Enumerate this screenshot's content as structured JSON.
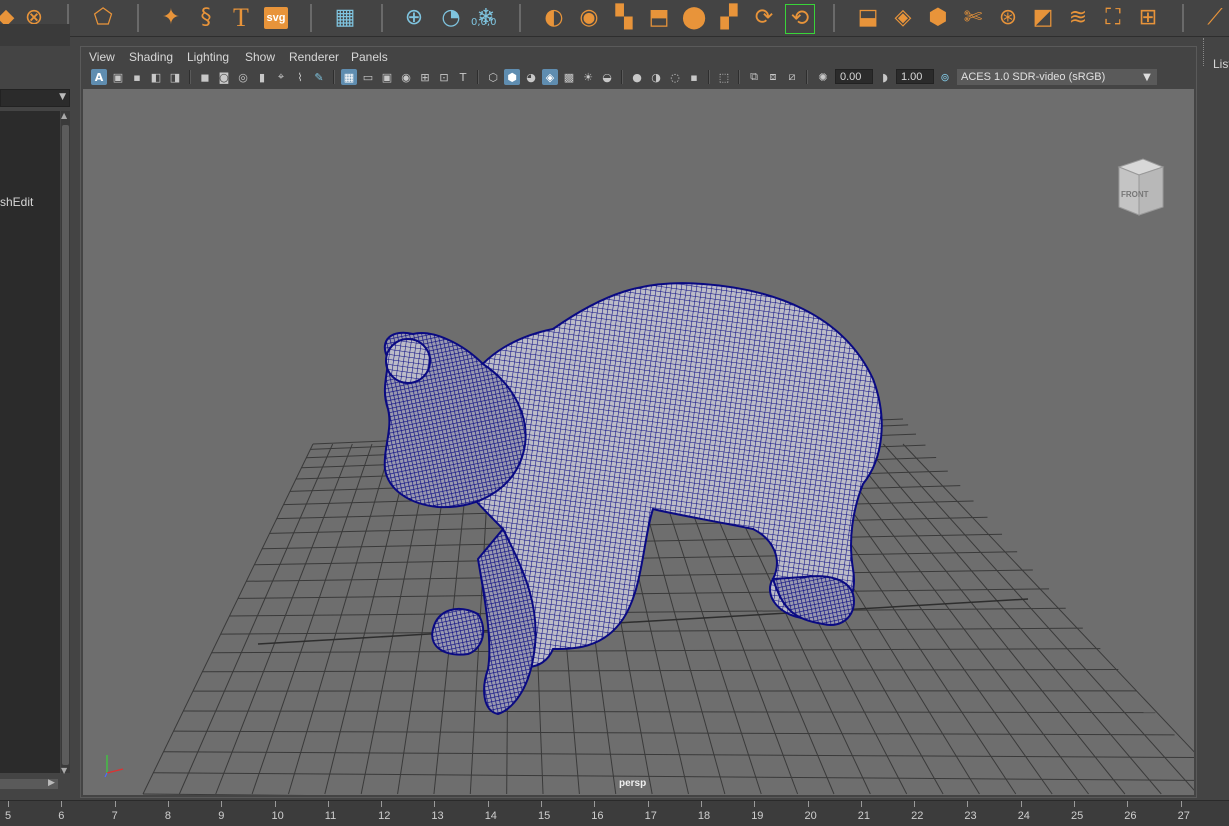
{
  "viewport_panel": {
    "menus": [
      "View",
      "Shading",
      "Lighting",
      "Show",
      "Renderer",
      "Panels"
    ],
    "exposure_value": "0.00",
    "gamma_value": "1.00",
    "color_space": "ACES 1.0 SDR-video (sRGB)",
    "camera_label": "persp",
    "view_cube_label": "FRONT"
  },
  "left_panel": {
    "visible_item": "shEdit"
  },
  "right_panel": {
    "label": "List"
  },
  "shelf": {
    "svg_label": "svg",
    "text_tool_label": "T",
    "xyz_readout": "0,0,0"
  },
  "time_ruler": {
    "labels": [
      "5",
      "6",
      "7",
      "8",
      "9",
      "10",
      "11",
      "12",
      "13",
      "14",
      "15",
      "16",
      "17",
      "18",
      "19",
      "20",
      "21",
      "22",
      "23",
      "24",
      "25",
      "26",
      "27"
    ]
  },
  "colors": {
    "wireframe": "#0a0a82",
    "grid": "#3a3a3a",
    "viewport_bg": "#6e6e6e",
    "shelf_icon": "#e8943a",
    "shelf_icon_blue": "#7fc4df",
    "active_tool": "#5f8db0"
  }
}
